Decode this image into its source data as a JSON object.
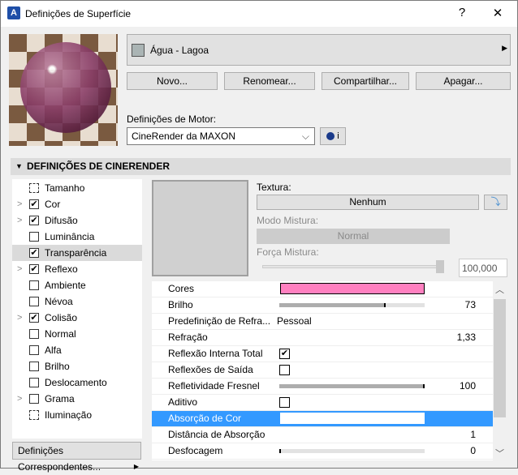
{
  "window": {
    "title": "Definições de Superfície",
    "help": "?",
    "close": "✕",
    "app_icon": "A"
  },
  "material": {
    "name": "Água - Lagoa",
    "swatch_color": "#aab4b4"
  },
  "buttons": {
    "new": "Novo...",
    "rename": "Renomear...",
    "share": "Compartilhar...",
    "delete": "Apagar..."
  },
  "engine": {
    "label": "Definições de Motor:",
    "value": "CineRender da MAXON",
    "info": "i"
  },
  "section": {
    "title": "DEFINIÇÕES DE CINERENDER"
  },
  "channels": [
    {
      "label": "Tamanho",
      "checkbox": null,
      "expand": false
    },
    {
      "label": "Cor",
      "checkbox": true,
      "expand": true
    },
    {
      "label": "Difusão",
      "checkbox": true,
      "expand": true
    },
    {
      "label": "Luminância",
      "checkbox": false,
      "expand": false
    },
    {
      "label": "Transparência",
      "checkbox": true,
      "expand": false,
      "selected": true
    },
    {
      "label": "Reflexo",
      "checkbox": true,
      "expand": true
    },
    {
      "label": "Ambiente",
      "checkbox": false,
      "expand": false
    },
    {
      "label": "Névoa",
      "checkbox": false,
      "expand": false
    },
    {
      "label": "Colisão",
      "checkbox": true,
      "expand": true
    },
    {
      "label": "Normal",
      "checkbox": false,
      "expand": false
    },
    {
      "label": "Alfa",
      "checkbox": false,
      "expand": false
    },
    {
      "label": "Brilho",
      "checkbox": false,
      "expand": false
    },
    {
      "label": "Deslocamento",
      "checkbox": false,
      "expand": false
    },
    {
      "label": "Grama",
      "checkbox": false,
      "expand": true
    },
    {
      "label": "Iluminação",
      "checkbox": null,
      "expand": false
    }
  ],
  "matching_button": "Definições Correspondentes...",
  "texture": {
    "label": "Textura:",
    "value": "Nenhum",
    "blend_mode_label": "Modo Mistura:",
    "blend_mode": "Normal",
    "blend_strength_label": "Força Mistura:",
    "blend_strength": "100,000",
    "blend_strength_fraction": 1.0
  },
  "properties": [
    {
      "label": "Cores",
      "type": "color",
      "color": "#ff80c0"
    },
    {
      "label": "Brilho",
      "type": "slider",
      "fraction": 0.73,
      "value": "73"
    },
    {
      "label": "Predefinição de Refra...",
      "type": "text",
      "text": "Pessoal"
    },
    {
      "label": "Refração",
      "type": "number",
      "value": "1,33"
    },
    {
      "label": "Reflexão Interna Total",
      "type": "check",
      "checked": true
    },
    {
      "label": "Reflexões de Saída",
      "type": "check",
      "checked": false
    },
    {
      "label": "Refletividade Fresnel",
      "type": "slider",
      "fraction": 1.0,
      "value": "100"
    },
    {
      "label": "Aditivo",
      "type": "check",
      "checked": false
    },
    {
      "label": "Absorção de Cor",
      "type": "color",
      "color": "#ffffff",
      "selected": true
    },
    {
      "label": "Distância de Absorção",
      "type": "number",
      "value": "1"
    },
    {
      "label": "Desfocagem",
      "type": "slider",
      "fraction": 0,
      "value": "0"
    }
  ]
}
